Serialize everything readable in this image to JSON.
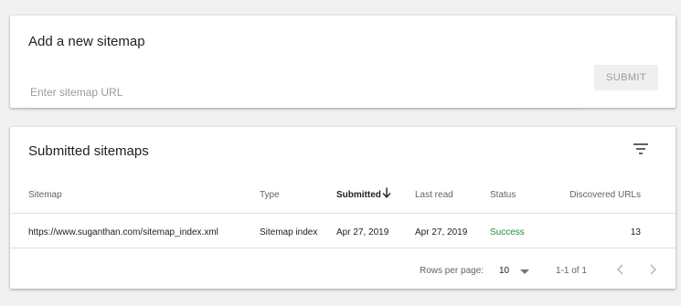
{
  "add_sitemap": {
    "title": "Add a new sitemap",
    "input_placeholder": "Enter sitemap URL",
    "submit_label": "SUBMIT"
  },
  "submitted": {
    "title": "Submitted sitemaps",
    "columns": {
      "sitemap": "Sitemap",
      "type": "Type",
      "submitted": "Submitted",
      "last_read": "Last read",
      "status": "Status",
      "discovered": "Discovered URLs"
    },
    "rows": [
      {
        "sitemap": "https://www.suganthan.com/sitemap_index.xml",
        "type": "Sitemap index",
        "submitted": "Apr 27, 2019",
        "last_read": "Apr 27, 2019",
        "status": "Success",
        "discovered": "13"
      }
    ],
    "pagination": {
      "rows_per_page_label": "Rows per page:",
      "rows_per_page_value": "10",
      "range": "1-1 of 1"
    }
  },
  "colors": {
    "success": "#1e8e3e",
    "background": "#f1f1f1",
    "button_bg": "#efefef",
    "button_text": "#9b9b9b"
  },
  "icons": {
    "filter": "filter-icon",
    "sort": "arrow-down-icon",
    "dropdown": "caret-down-icon",
    "prev": "chevron-left-icon",
    "next": "chevron-right-icon"
  }
}
